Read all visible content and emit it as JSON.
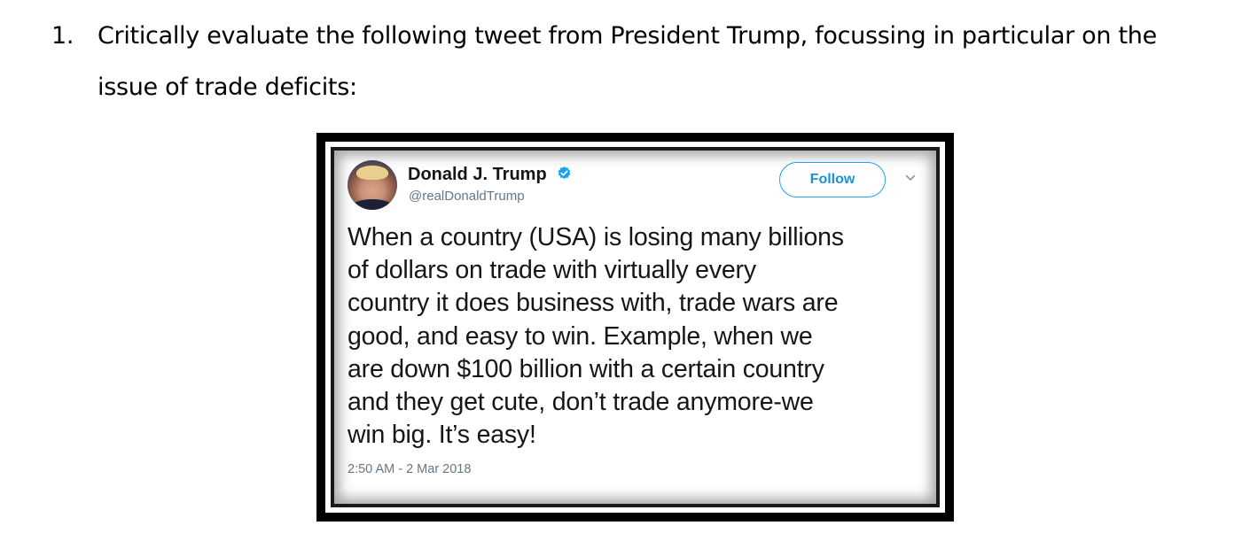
{
  "question": {
    "number": "1.",
    "line1": "Critically evaluate the following tweet from President Trump, focussing in particular on the",
    "line2": "issue of trade deficits:"
  },
  "tweet": {
    "author_name": "Donald J. Trump",
    "handle": "@realDonaldTrump",
    "verified": true,
    "follow_label": "Follow",
    "text_lines": [
      "When a country (USA) is losing many billions",
      "of dollars on trade with virtually every",
      "country it does business with, trade wars are",
      "good, and easy to win. Example, when we",
      "are down $100 billion with a certain country",
      "and they get cute, don’t trade anymore-we",
      "win big. It’s easy!"
    ],
    "timestamp": "2:50 AM - 2 Mar 2018",
    "colors": {
      "accent": "#1da1f2",
      "secondary_text": "#657786",
      "primary_text": "#14171a"
    }
  }
}
